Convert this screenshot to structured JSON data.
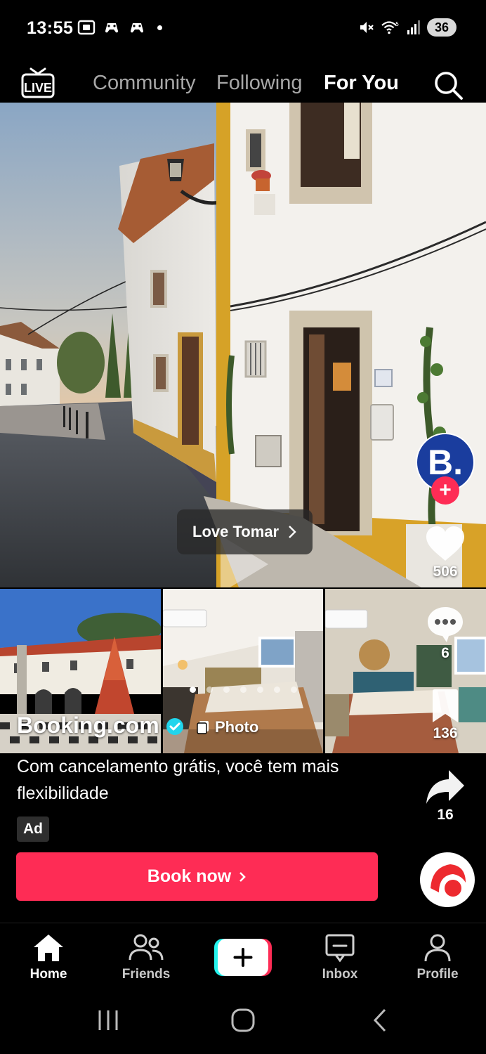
{
  "status_bar": {
    "time": "13:55",
    "battery": "36"
  },
  "top_nav": {
    "live_label": "LIVE",
    "tabs": [
      {
        "label": "Community",
        "active": false
      },
      {
        "label": "Following",
        "active": false
      },
      {
        "label": "For You",
        "active": true
      }
    ]
  },
  "post": {
    "place_tag": "Love Tomar",
    "account": "Booking.com",
    "content_type": "Photo",
    "caption": "Com cancelamento grátis, você tem mais flexibilidade",
    "ad_label": "Ad",
    "cta_label": "Book now",
    "photo_count": 7,
    "current_photo_index": 0,
    "avatar_letter": "B."
  },
  "actions": {
    "likes": "506",
    "comments": "6",
    "saves": "136",
    "shares": "16"
  },
  "tabbar": {
    "home": "Home",
    "friends": "Friends",
    "inbox": "Inbox",
    "profile": "Profile"
  },
  "colors": {
    "accent": "#fe2c55",
    "booking_blue": "#1a3d9e",
    "background": "#000000"
  }
}
